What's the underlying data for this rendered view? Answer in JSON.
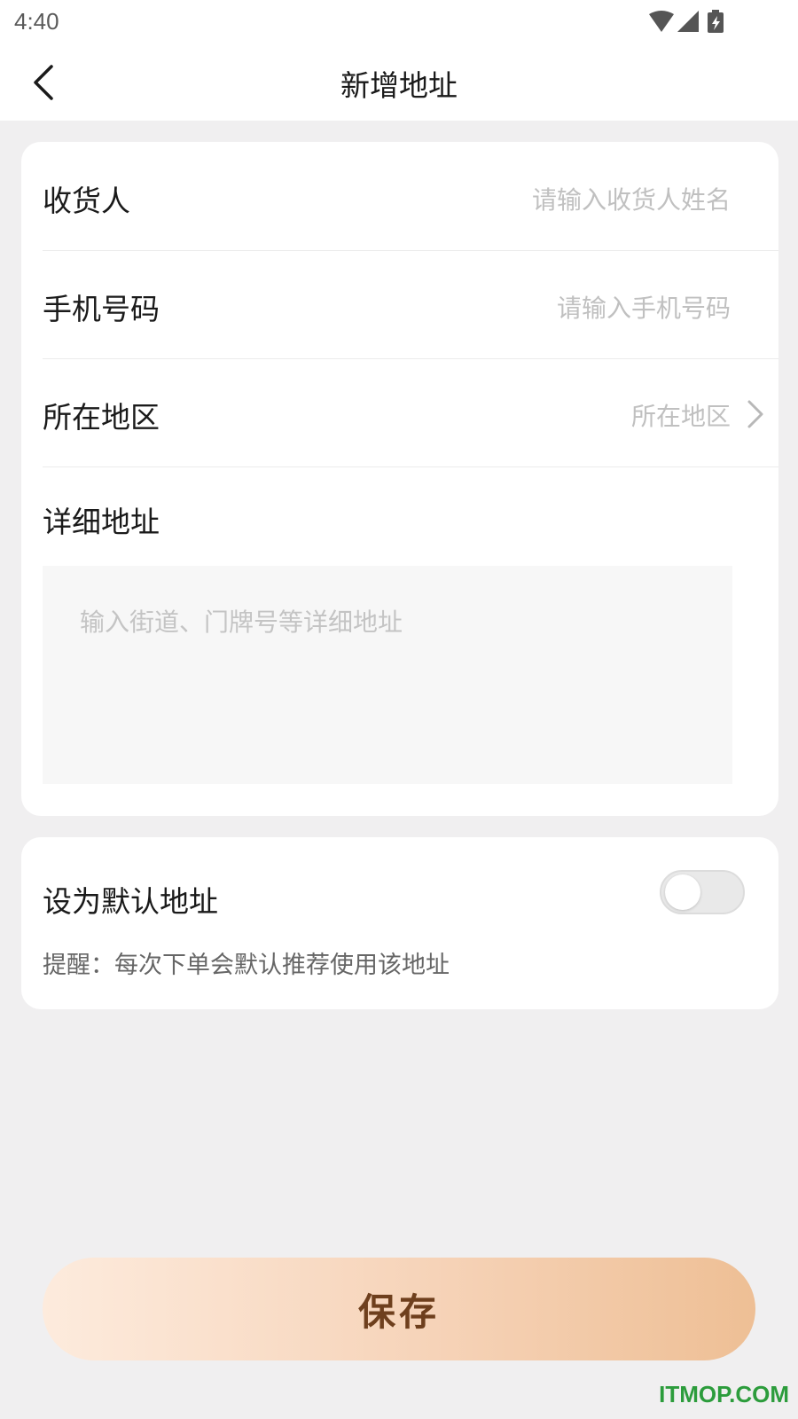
{
  "status_bar": {
    "time": "4:40",
    "icons": [
      "wifi-icon",
      "cell-signal-icon",
      "battery-charging-icon"
    ]
  },
  "nav": {
    "back_icon": "chevron-left-icon",
    "title": "新增地址"
  },
  "form": {
    "recipient": {
      "label": "收货人",
      "placeholder": "请输入收货人姓名",
      "value": ""
    },
    "phone": {
      "label": "手机号码",
      "placeholder": "请输入手机号码",
      "value": ""
    },
    "region": {
      "label": "所在地区",
      "placeholder": "所在地区",
      "icon": "chevron-right-icon"
    },
    "detail": {
      "label": "详细地址",
      "placeholder": "输入街道、门牌号等详细地址",
      "value": ""
    }
  },
  "default_address": {
    "label": "设为默认地址",
    "enabled": false,
    "hint": "提醒：每次下单会默认推荐使用该地址"
  },
  "save_button": {
    "label": "保存"
  },
  "watermark": "ITMOP.COM",
  "colors": {
    "background": "#f0eff0",
    "card": "#ffffff",
    "placeholder": "#c0c0c0",
    "save_text": "#6e3f1d",
    "save_gradient_start": "#fdebdd",
    "save_gradient_end": "#eebf95",
    "watermark": "#2c9c3c"
  }
}
